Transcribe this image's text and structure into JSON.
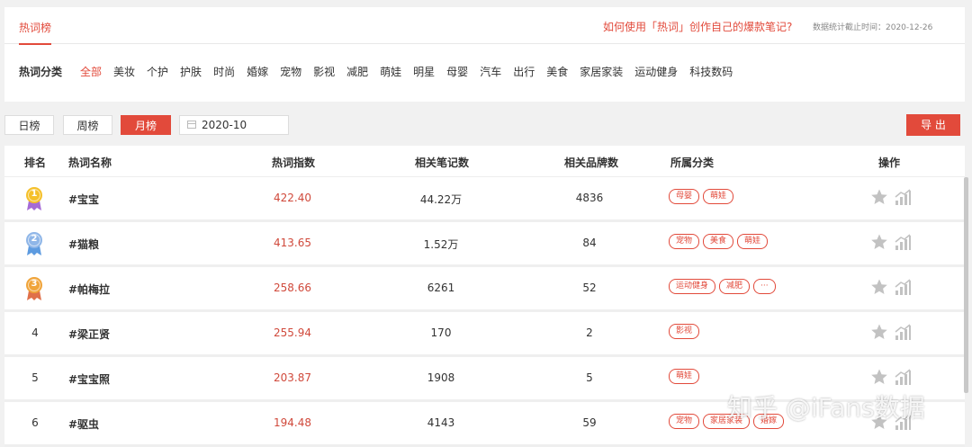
{
  "tabs": {
    "active": "热词榜"
  },
  "help_link": "如何使用「热词」创作自己的爆款笔记?",
  "stat_date": "数据统计截止时间：2020-12-26",
  "categories": {
    "label": "热词分类",
    "items": [
      "全部",
      "美妆",
      "个护",
      "护肤",
      "时尚",
      "婚嫁",
      "宠物",
      "影视",
      "减肥",
      "萌娃",
      "明星",
      "母婴",
      "汽车",
      "出行",
      "美食",
      "家居家装",
      "运动健身",
      "科技数码"
    ],
    "active": "全部"
  },
  "period": {
    "day": "日榜",
    "week": "周榜",
    "month": "月榜",
    "active": "月榜"
  },
  "date_value": "2020-10",
  "export_label": "导 出",
  "table": {
    "headers": {
      "rank": "排名",
      "name": "热词名称",
      "index": "热词指数",
      "notes": "相关笔记数",
      "brands": "相关品牌数",
      "category": "所属分类",
      "ops": "操作"
    },
    "rows": [
      {
        "rank": "1",
        "medal": "gold",
        "name": "#宝宝",
        "index": "422.40",
        "notes": "44.22万",
        "brands": "4836",
        "tags": [
          "母婴",
          "萌娃"
        ]
      },
      {
        "rank": "2",
        "medal": "silver",
        "name": "#猫粮",
        "index": "413.65",
        "notes": "1.52万",
        "brands": "84",
        "tags": [
          "宠物",
          "美食",
          "萌娃"
        ]
      },
      {
        "rank": "3",
        "medal": "bronze",
        "name": "#帕梅拉",
        "index": "258.66",
        "notes": "6261",
        "brands": "52",
        "tags": [
          "运动健身",
          "减肥",
          "···"
        ]
      },
      {
        "rank": "4",
        "medal": "",
        "name": "#梁正贤",
        "index": "255.94",
        "notes": "170",
        "brands": "2",
        "tags": [
          "影视"
        ]
      },
      {
        "rank": "5",
        "medal": "",
        "name": "#宝宝照",
        "index": "203.87",
        "notes": "1908",
        "brands": "5",
        "tags": [
          "萌娃"
        ]
      },
      {
        "rank": "6",
        "medal": "",
        "name": "#驱虫",
        "index": "194.48",
        "notes": "4143",
        "brands": "59",
        "tags": [
          "宠物",
          "家居家装",
          "婚嫁"
        ]
      }
    ]
  },
  "colors": {
    "accent": "#e24a3b",
    "gold": "#f5c02a",
    "silver": "#8fb6e8",
    "bronze": "#f0a43a",
    "icon_gray": "#c2c2c2"
  },
  "watermark": "知乎 @iFans数据"
}
